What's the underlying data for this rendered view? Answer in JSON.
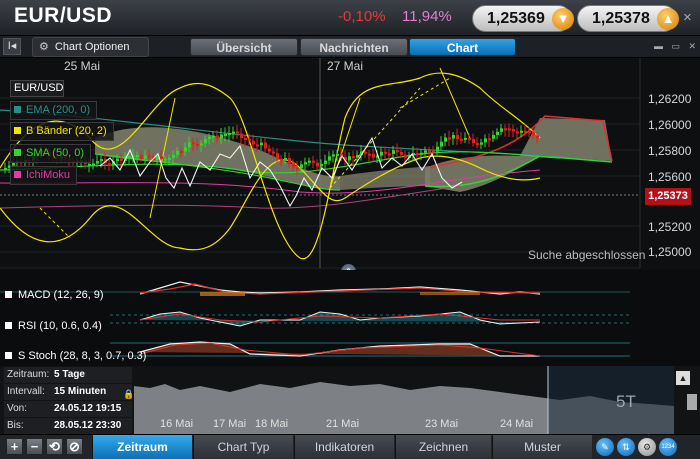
{
  "header": {
    "symbol": "EUR/USD",
    "change_abs": "-0,10%",
    "change_pct": "11,94%",
    "bid": "1,25369",
    "ask": "1,25378",
    "close_label": "×"
  },
  "toolbar": {
    "back_label": "I◂",
    "options_label": "Chart Optionen",
    "tabs": [
      {
        "label": "Übersicht",
        "active": false
      },
      {
        "label": "Nachrichten",
        "active": false
      },
      {
        "label": "Chart",
        "active": true
      }
    ],
    "window_buttons": "▬ ▭ ✕"
  },
  "chart": {
    "dates": [
      "25 Mai",
      "27 Mai"
    ],
    "legend_title": "EUR/USD",
    "legend": [
      {
        "label": "EMA (200, 0)",
        "color": "#2a8f86"
      },
      {
        "label": "B Bänder (20, 2)",
        "color": "#f2e600"
      },
      {
        "label": "SMA (50, 0)",
        "color": "#33d433"
      },
      {
        "label": "IchiMoku",
        "color": "#e03aa8"
      }
    ],
    "price_axis": [
      "1,26200",
      "1,26000",
      "1,25800",
      "1,25600",
      "1,25373",
      "1,25200",
      "1,25000"
    ],
    "current_price": "1,25373",
    "status": "Suche abgeschlossen"
  },
  "indicators": [
    {
      "label": "MACD (12, 26, 9)"
    },
    {
      "label": "RSI (10, 0.6, 0.4)"
    },
    {
      "label": "S Stoch (28, 8, 3, 0.7, 0.3)"
    }
  ],
  "info": {
    "zeitraum_k": "Zeitraum:",
    "zeitraum_v": "5 Tage",
    "intervall_k": "Intervall:",
    "intervall_v": "15 Minuten",
    "von_k": "Von:",
    "von_v": "24.05.12 19:15",
    "bis_k": "Bis:",
    "bis_v": "28.05.12 23:30"
  },
  "navigator": {
    "dates": [
      "16 Mai",
      "17 Mai",
      "18 Mai",
      "21 Mai",
      "23 Mai",
      "24 Mai"
    ],
    "period_label": "5T"
  },
  "bottom_tabs": [
    {
      "label": "Zeitraum",
      "active": true
    },
    {
      "label": "Chart Typ",
      "active": false
    },
    {
      "label": "Indikatoren",
      "active": false
    },
    {
      "label": "Zeichnen",
      "active": false
    },
    {
      "label": "Muster",
      "active": false
    }
  ],
  "bottom_buttons": [
    "+",
    "−",
    "⟲",
    "⊘"
  ],
  "round_buttons": [
    "✎",
    "⇅",
    "⚙",
    "1234"
  ]
}
